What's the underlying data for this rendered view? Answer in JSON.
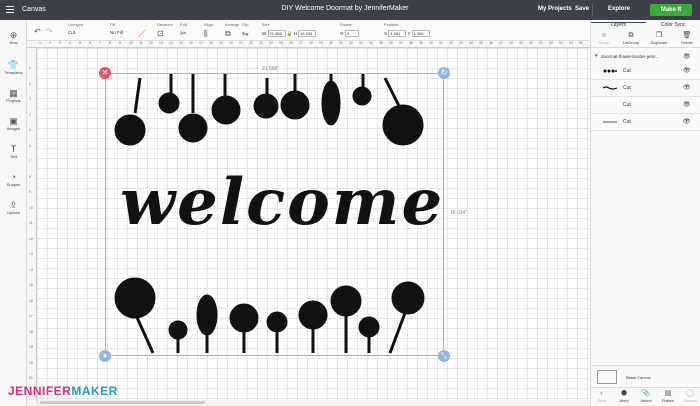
{
  "topbar": {
    "app_name": "Canvas",
    "title": "DIY Welcome Doormat by JenniferMaker",
    "my_projects": "My Projects",
    "save": "Save",
    "explore": "Explore",
    "make_it": "Make It"
  },
  "toolbar": {
    "linetype": {
      "label": "Linetype",
      "value": "Cut"
    },
    "fill": {
      "label": "Fill",
      "value": "No Fill"
    },
    "deselect": {
      "label": "Deselect"
    },
    "edit": {
      "label": "Edit"
    },
    "align": {
      "label": "Align"
    },
    "arrange": {
      "label": "Arrange"
    },
    "flip": {
      "label": "Flip"
    },
    "size": {
      "label": "Size",
      "w_label": "W",
      "w": "21.588",
      "h_label": "H",
      "h": "18.034"
    },
    "rotate": {
      "label": "Rotate",
      "value": "0"
    },
    "position": {
      "label": "Position",
      "x_label": "X",
      "x": "4.981",
      "y_label": "Y",
      "y": "1.966"
    }
  },
  "ruler": {
    "top": [
      "1",
      "2",
      "3",
      "4",
      "5",
      "6",
      "7",
      "8",
      "9",
      "10",
      "11",
      "12",
      "13",
      "14",
      "15",
      "16",
      "17",
      "18",
      "19",
      "20",
      "21",
      "22",
      "23",
      "24",
      "25",
      "26",
      "27",
      "28",
      "29",
      "30",
      "31",
      "32",
      "33",
      "34",
      "35",
      "36",
      "37",
      "38",
      "39",
      "40",
      "41",
      "42",
      "43",
      "44",
      "45",
      "46",
      "47",
      "48",
      "49",
      "50",
      "51",
      "52",
      "53",
      "54",
      "55"
    ],
    "left": [
      "1",
      "2",
      "3",
      "4",
      "5",
      "6",
      "7",
      "8",
      "9",
      "10",
      "11",
      "12",
      "13",
      "14",
      "15",
      "16",
      "17",
      "18",
      "19",
      "20",
      "21",
      "22"
    ]
  },
  "sidebar": {
    "items": [
      {
        "label": "New",
        "icon": "plus-icon"
      },
      {
        "label": "Templates",
        "icon": "shirt-icon"
      },
      {
        "label": "Projects",
        "icon": "projects-icon"
      },
      {
        "label": "Images",
        "icon": "image-icon"
      },
      {
        "label": "Text",
        "icon": "text-icon"
      },
      {
        "label": "Shapes",
        "icon": "shapes-icon"
      },
      {
        "label": "Upload",
        "icon": "upload-icon"
      }
    ]
  },
  "canvas": {
    "width_label": "21.588\"",
    "height_label": "18.034\"",
    "word": "welcome"
  },
  "layers_panel": {
    "tab_layers": "Layers",
    "tab_color_sync": "Color Sync",
    "actions": [
      "Group",
      "UnGroup",
      "Duplicate",
      "Delete"
    ],
    "group_name": "doormat-flower-border-jenn...",
    "layers": [
      {
        "name": "Cut"
      },
      {
        "name": "Cut"
      },
      {
        "name": "Cut"
      },
      {
        "name": "Cut"
      }
    ],
    "blank_canvas": "Blank Canvas",
    "bottom_actions": [
      "Slice",
      "Weld",
      "Attach",
      "Flatten",
      "Contour"
    ]
  },
  "branding": {
    "part1": "JENNIFER",
    "part2": "MAKER"
  },
  "colors": {
    "topbar": "#3c4048",
    "make_it": "#3fa83f",
    "close_handle": "#e2546a",
    "selection": "#8fb7e0"
  }
}
